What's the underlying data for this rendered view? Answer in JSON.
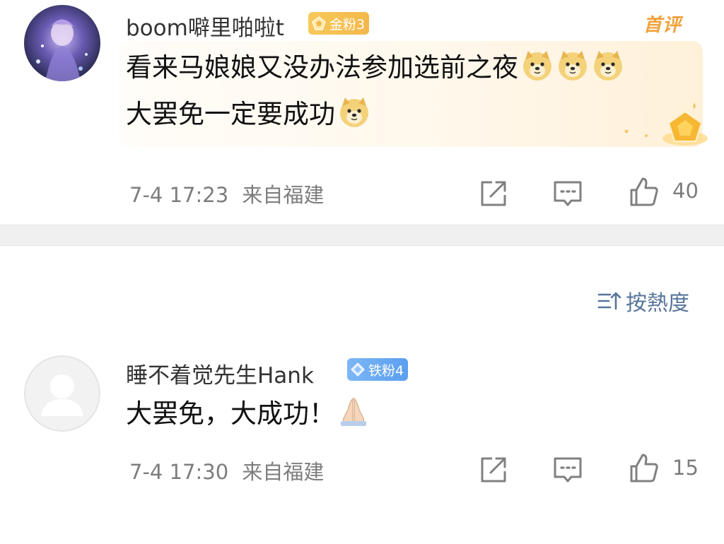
{
  "comments": [
    {
      "username": "boom噼里啪啦t",
      "badge": {
        "label": "金粉3",
        "icon": "gold-fan-icon",
        "color": "#f3b84a"
      },
      "tag": "首评",
      "text_lines": [
        "看来马娘娘又没办法参加选前之夜",
        "大罢免一定要成功"
      ],
      "time": "7-4 17:23",
      "location": "来自福建",
      "likes": "40"
    },
    {
      "username": "睡不着觉先生Hank",
      "badge": {
        "label": "铁粉4",
        "icon": "diamond-icon",
        "color": "#5b9ff0"
      },
      "text_lines": [
        "大罢免，大成功！"
      ],
      "time": "7-4 17:30",
      "location": "来自福建",
      "likes": "15"
    }
  ],
  "sort": {
    "label": "按熱度",
    "icon": "sort-icon"
  },
  "colors": {
    "link": "#57749b",
    "meta": "#7d7d7d",
    "gold": "#f0a13a"
  }
}
